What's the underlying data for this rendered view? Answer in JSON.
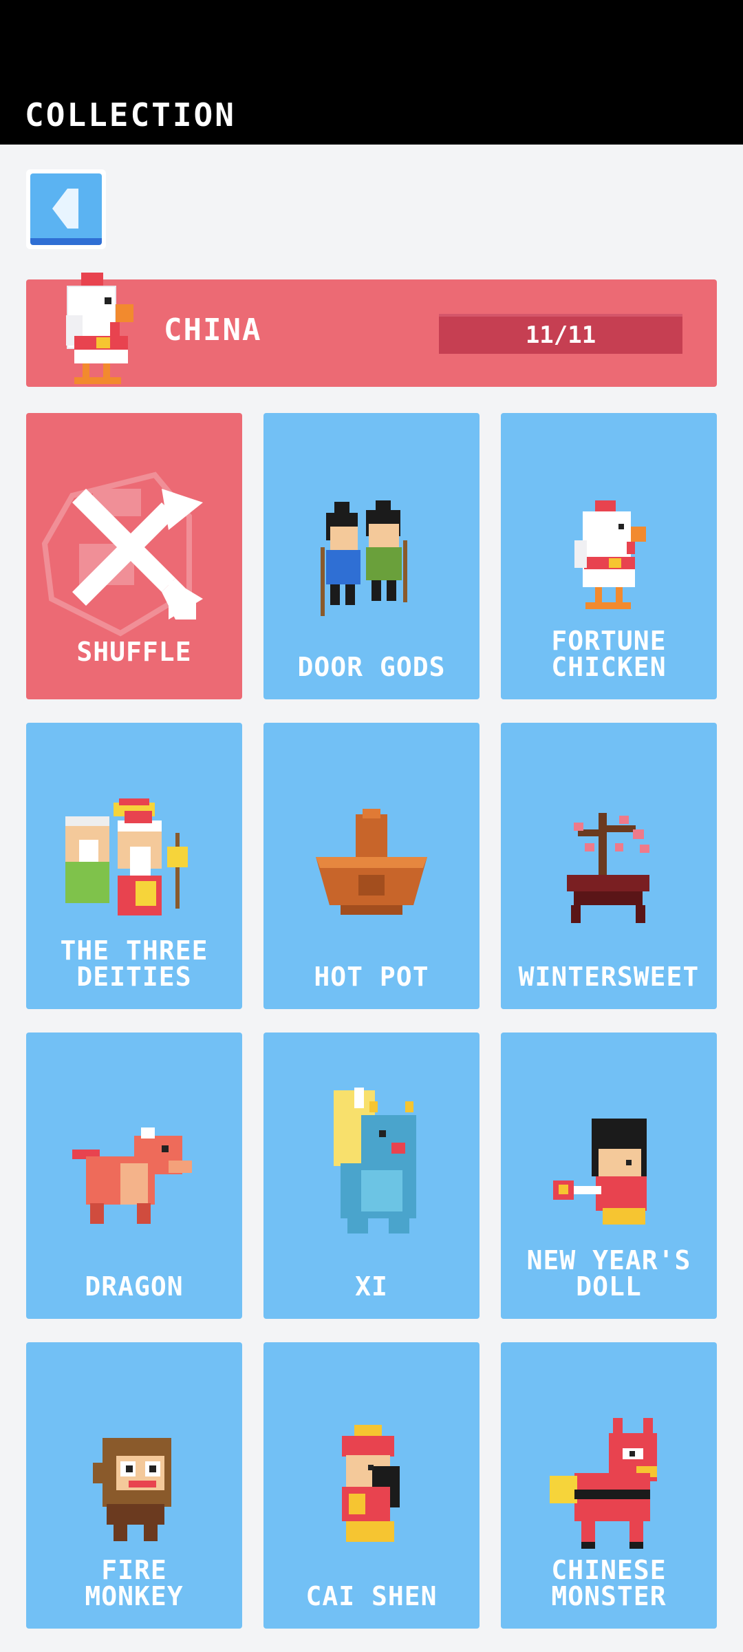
{
  "header": {
    "title": "COLLECTION"
  },
  "back_button": {
    "icon": "back-arrow-icon"
  },
  "banner": {
    "name": "CHINA",
    "progress_text": "11/11",
    "progress_fraction": 1.0,
    "icon": "chicken-icon"
  },
  "colors": {
    "background": "#f3f4f6",
    "topbar": "#000000",
    "card_blue": "#72c0f5",
    "card_red": "#ec6a74",
    "progress": "#c63f52"
  },
  "cards": [
    {
      "label": "SHUFFLE",
      "icon": "shuffle-icon"
    },
    {
      "label": "DOOR GODS",
      "icon": "door-gods-icon"
    },
    {
      "label": "FORTUNE\nCHICKEN",
      "icon": "fortune-chicken-icon"
    },
    {
      "label": "THE THREE\nDEITIES",
      "icon": "three-deities-icon"
    },
    {
      "label": "HOT POT",
      "icon": "hot-pot-icon"
    },
    {
      "label": "WINTERSWEET",
      "icon": "wintersweet-icon"
    },
    {
      "label": "DRAGON",
      "icon": "dragon-icon"
    },
    {
      "label": "XI",
      "icon": "xi-icon"
    },
    {
      "label": "NEW YEAR'S\nDOLL",
      "icon": "new-years-doll-icon"
    },
    {
      "label": "FIRE\nMONKEY",
      "icon": "fire-monkey-icon"
    },
    {
      "label": "CAI SHEN",
      "icon": "cai-shen-icon"
    },
    {
      "label": "CHINESE\nMONSTER",
      "icon": "chinese-monster-icon"
    }
  ]
}
